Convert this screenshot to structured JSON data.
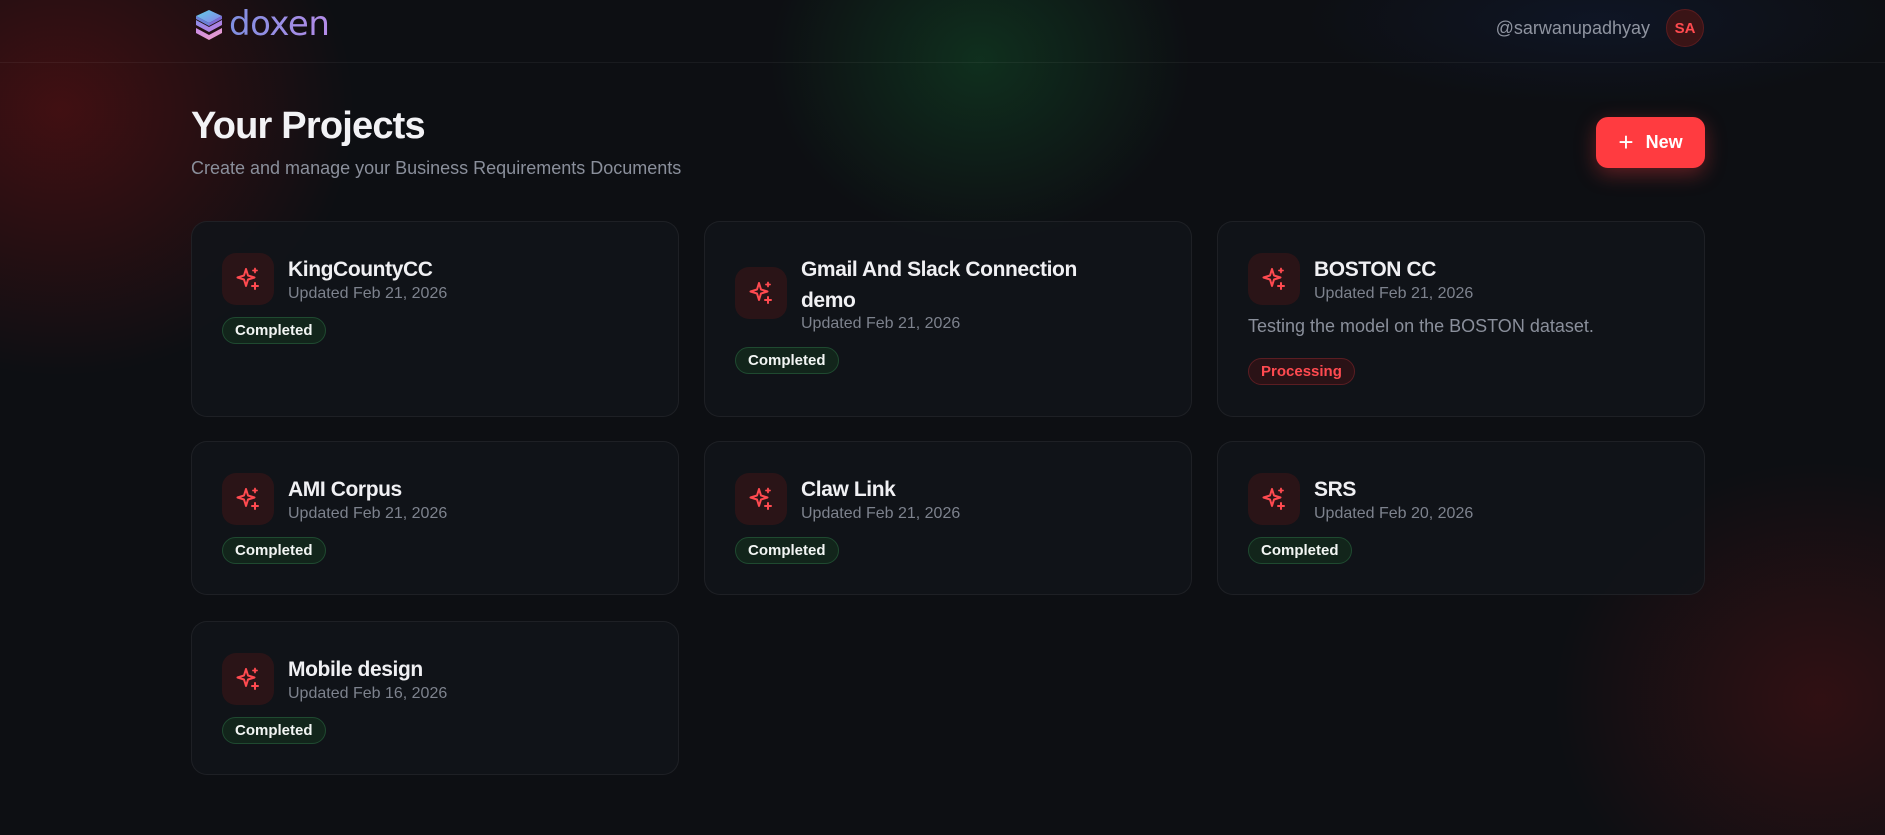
{
  "header": {
    "logo_text": "doxen",
    "username": "@sarwanupadhyay",
    "avatar_initials": "SA"
  },
  "page": {
    "title": "Your Projects",
    "subtitle": "Create and manage your Business Requirements Documents",
    "new_button_label": "New"
  },
  "projects": [
    {
      "title": "KingCountyCC",
      "updated": "Updated Feb 21, 2026",
      "description": "",
      "status": "Completed"
    },
    {
      "title": "Gmail And Slack Connection demo",
      "updated": "Updated Feb 21, 2026",
      "description": "",
      "status": "Completed"
    },
    {
      "title": "BOSTON CC",
      "updated": "Updated Feb 21, 2026",
      "description": "Testing the model on the BOSTON dataset.",
      "status": "Processing"
    },
    {
      "title": "AMI Corpus",
      "updated": "Updated Feb 21, 2026",
      "description": "",
      "status": "Completed"
    },
    {
      "title": "Claw Link",
      "updated": "Updated Feb 21, 2026",
      "description": "",
      "status": "Completed"
    },
    {
      "title": "SRS",
      "updated": "Updated Feb 20, 2026",
      "description": "",
      "status": "Completed"
    },
    {
      "title": "Mobile design",
      "updated": "Updated Feb 16, 2026",
      "description": "",
      "status": "Completed"
    }
  ],
  "colors": {
    "accent": "#ff3b40",
    "background": "#0d0f13",
    "completed_badge": "#12251b",
    "processing_badge": "#2a1216"
  },
  "icons": {
    "logo": "stacked-layers-icon",
    "project": "sparkles-icon",
    "new": "plus-icon"
  }
}
